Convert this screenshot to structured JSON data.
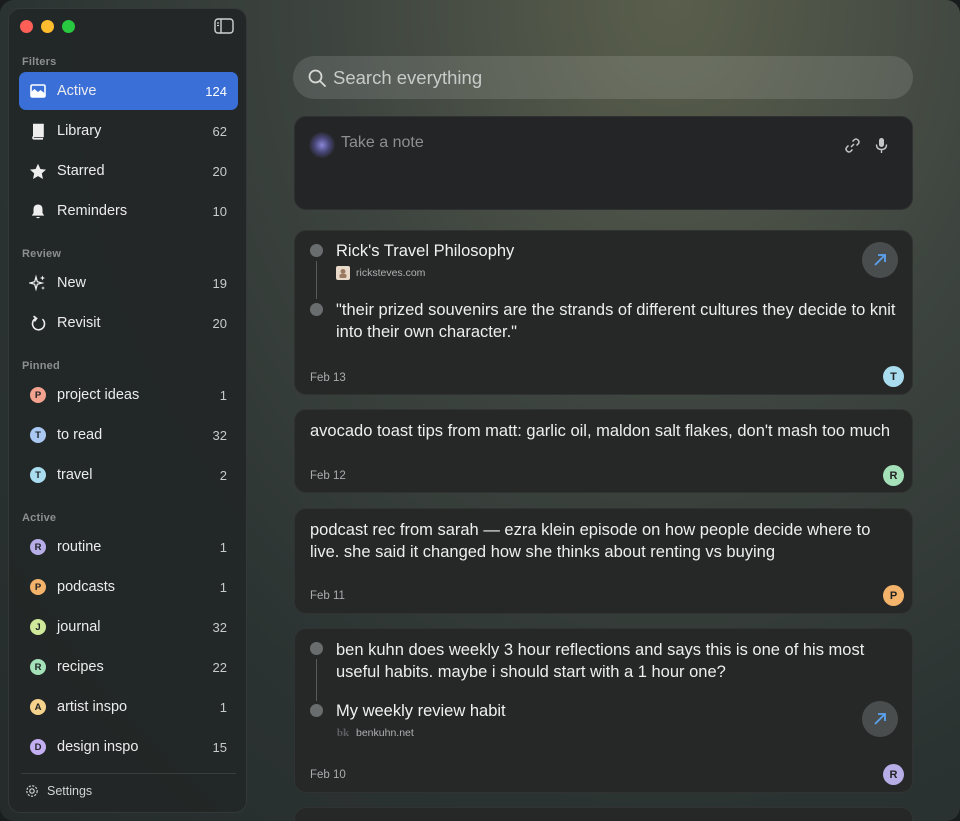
{
  "sidebar": {
    "sections": {
      "filters": "Filters",
      "review": "Review",
      "pinned": "Pinned",
      "active": "Active"
    },
    "filters": [
      {
        "label": "Active",
        "count": "124",
        "icon": "inbox-icon",
        "selected": true
      },
      {
        "label": "Library",
        "count": "62",
        "icon": "book-icon"
      },
      {
        "label": "Starred",
        "count": "20",
        "icon": "star-icon"
      },
      {
        "label": "Reminders",
        "count": "10",
        "icon": "bell-icon"
      }
    ],
    "review": [
      {
        "label": "New",
        "count": "19",
        "icon": "sparkles-icon"
      },
      {
        "label": "Revisit",
        "count": "20",
        "icon": "refresh-icon"
      }
    ],
    "pinned": [
      {
        "label": "project ideas",
        "count": "1",
        "letter": "P",
        "color": "#f2a28e"
      },
      {
        "label": "to read",
        "count": "32",
        "letter": "T",
        "color": "#a9c9f2"
      },
      {
        "label": "travel",
        "count": "2",
        "letter": "T",
        "color": "#a9dcef"
      }
    ],
    "active": [
      {
        "label": "routine",
        "count": "1",
        "letter": "R",
        "color": "#b7aee8"
      },
      {
        "label": "podcasts",
        "count": "1",
        "letter": "P",
        "color": "#f4b36b"
      },
      {
        "label": "journal",
        "count": "32",
        "letter": "J",
        "color": "#cfe89a"
      },
      {
        "label": "recipes",
        "count": "22",
        "letter": "R",
        "color": "#a4e0b8"
      },
      {
        "label": "artist inspo",
        "count": "1",
        "letter": "A",
        "color": "#f6d38c"
      },
      {
        "label": "design inspo",
        "count": "15",
        "letter": "D",
        "color": "#c3aef2"
      }
    ],
    "settings": "Settings"
  },
  "search": {
    "placeholder": "Search everything"
  },
  "composer": {
    "placeholder": "Take a note"
  },
  "cards": [
    {
      "title": "Rick's Travel Philosophy",
      "source": "ricksteves.com",
      "quote": "\"their prized souvenirs are the strands of different cultures they decide to knit into their own character.\"",
      "date": "Feb 13",
      "avatar": "T",
      "avatar_color": "#a9dcef"
    },
    {
      "text": "avocado toast tips from matt: garlic oil, maldon salt flakes, don't mash too much",
      "date": "Feb 12",
      "avatar": "R",
      "avatar_color": "#a4e0b8"
    },
    {
      "text": "podcast rec from sarah — ezra klein episode on how people decide where to live. she said it changed how she thinks about renting vs buying",
      "date": "Feb 11",
      "avatar": "P",
      "avatar_color": "#f4b36b"
    },
    {
      "text": "ben kuhn does weekly 3 hour reflections and says this is one of his most useful habits. maybe i should start with a 1 hour one?",
      "title": "My weekly review habit",
      "source": "benkuhn.net",
      "favicon_text": "bk",
      "date": "Feb 10",
      "avatar": "R",
      "avatar_color": "#b7aee8"
    }
  ]
}
